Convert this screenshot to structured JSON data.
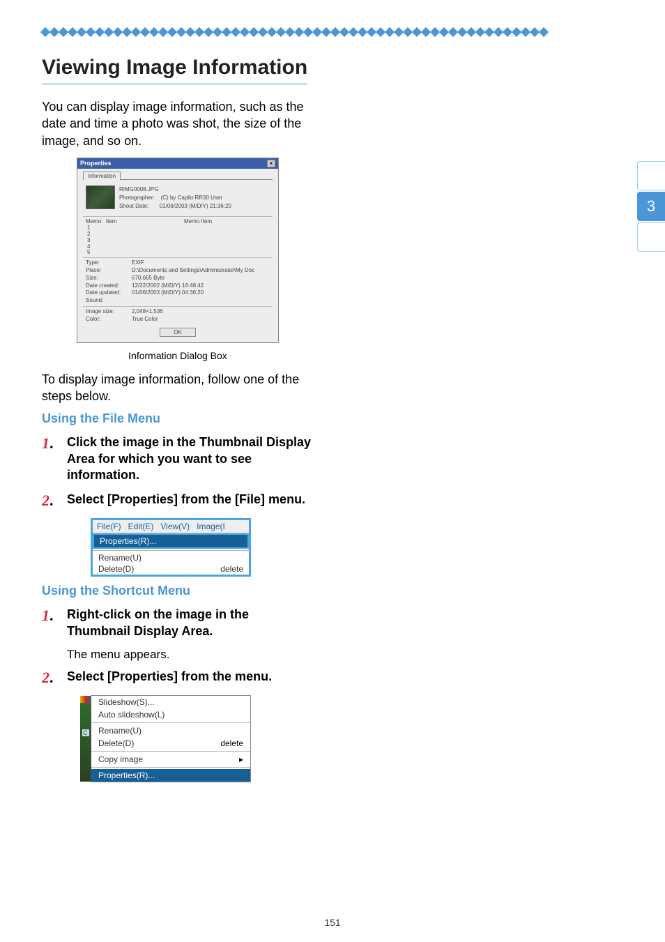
{
  "page_number": "151",
  "side_tab": "3",
  "title": "Viewing Image Information",
  "intro": "You can display image information, such as the date and time a photo was shot, the size of the image, and so on.",
  "fig1_caption": "Information Dialog Box",
  "props": {
    "window_title": "Properties",
    "close": "×",
    "tab": "Information",
    "filename": "RIMG0008.JPG",
    "photographer_label": "Photographer:",
    "photographer_value": "(C) by Caplio RR30 User",
    "shootdate_label": "Shoot Date:",
    "shootdate_value": "01/06/2003 (M/D/Y)  21:36:20",
    "memo_label": "Memo:",
    "memo_item_label": "Item",
    "memo_header": "Memo Item",
    "memo_nums": [
      "1",
      "2",
      "3",
      "4",
      "5"
    ],
    "rows": [
      {
        "label": "Type:",
        "value": "EXIF"
      },
      {
        "label": "Place:",
        "value": "D:\\Documents and Settings\\Administrator\\My Doc"
      },
      {
        "label": "Size:",
        "value": "670,665 Byte"
      },
      {
        "label": "Date created:",
        "value": "12/22/2002 (M/D/Y)  16:48:42"
      },
      {
        "label": "Date updated:",
        "value": "01/06/2003 (M/D/Y)  04:36:20"
      },
      {
        "label": "Sound:",
        "value": ""
      }
    ],
    "rows2": [
      {
        "label": "Image size:",
        "value": "2,048×1,536"
      },
      {
        "label": "Color:",
        "value": "True Color"
      }
    ],
    "ok": "OK"
  },
  "para2": "To display image information, follow one of the steps below.",
  "section1_title": "Using the File Menu",
  "section1_step1": "Click the image in the Thumbnail Display Area for which you want to see information.",
  "section1_step2": "Select [Properties] from the [File] menu.",
  "menu1": {
    "menubar": [
      "File(F)",
      "Edit(E)",
      "View(V)",
      "Image(I"
    ],
    "highlight": "Properties(R)...",
    "rows": [
      {
        "l": "Rename(U)",
        "r": ""
      },
      {
        "l": "Delete(D)",
        "r": "delete"
      }
    ]
  },
  "section2_title": "Using the Shortcut Menu",
  "section2_step1": "Right-click on the image in the Thumbnail Display Area.",
  "section2_sub": "The menu appears.",
  "section2_step2": "Select [Properties] from the menu.",
  "menu2": {
    "rows1": [
      {
        "l": "Slideshow(S)...",
        "r": ""
      },
      {
        "l": "Auto slideshow(L)",
        "r": ""
      }
    ],
    "rows2": [
      {
        "l": "Rename(U)",
        "r": ""
      },
      {
        "l": "Delete(D)",
        "r": "delete"
      }
    ],
    "rows3": [
      {
        "l": "Copy image",
        "r": "▸"
      }
    ],
    "highlight": "Properties(R)..."
  }
}
